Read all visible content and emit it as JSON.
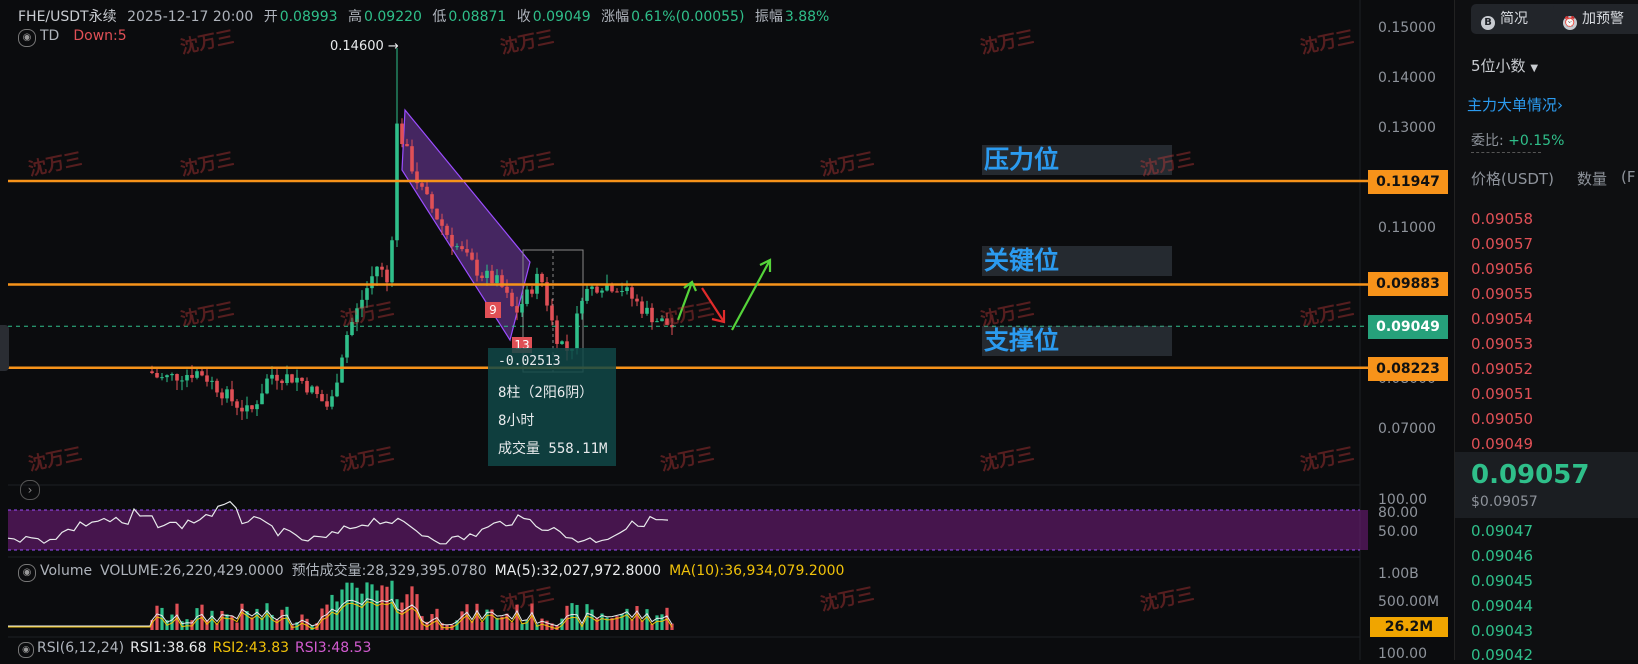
{
  "header": {
    "symbol": "FHE/USDT永续",
    "datetime": "2025-12-17 20:00",
    "open_label": "开",
    "open": "0.08993",
    "high_label": "高",
    "high": "0.09220",
    "low_label": "低",
    "low": "0.08871",
    "close_label": "收",
    "close": "0.09049",
    "change_label": "涨幅",
    "change": "0.61%(0.00055)",
    "amp_label": "振幅",
    "amp": "3.88%"
  },
  "indicator_row": {
    "name": "TD",
    "down": "Down:5"
  },
  "watermark": "沈万三",
  "peak_label": "0.14600 →",
  "td_labels": {
    "nine": "9",
    "thirteen": "13"
  },
  "measure_box": {
    "delta": "-0.02513",
    "bars": "8柱（2阳6阴）",
    "hours": "8小时",
    "volume": "成交量 558.11M"
  },
  "zones": {
    "pressure": "压力位",
    "key": "关键位",
    "support": "支撑位"
  },
  "price_axis": {
    "ticks": [
      "0.15000",
      "0.14000",
      "0.13000",
      "0.11000",
      "0.08000",
      "0.07000"
    ],
    "levels": [
      "0.11947",
      "0.09883",
      "0.09049",
      "0.08223"
    ]
  },
  "rsi_axis": {
    "ticks": [
      "100.00",
      "80.00",
      "50.00"
    ]
  },
  "volume_panel": {
    "label": "Volume",
    "volume": "VOLUME:26,220,429.0000",
    "est": "预估成交量:28,329,395.0780",
    "ma5": "MA(5):32,027,972.8000",
    "ma10": "MA(10):36,934,079.2000",
    "ticks": [
      "1.00B",
      "500.00M"
    ],
    "current": "26.2M"
  },
  "rsi_panel": {
    "label": "RSI(6,12,24)",
    "rsi1": "RSI1:38.68",
    "rsi2": "RSI2:43.83",
    "rsi3": "RSI3:48.53",
    "tick": "100.00"
  },
  "right_panel": {
    "btn_simple": "简况",
    "btn_alert": "加预警",
    "decimals": "5位小数",
    "main_orders": "主力大单情况",
    "ratio_label": "委比:",
    "ratio": "+0.15%",
    "col_price": "价格(USDT)",
    "col_qty": "数量",
    "col_extra": "(F",
    "asks": [
      "0.09058",
      "0.09057",
      "0.09056",
      "0.09055",
      "0.09054",
      "0.09053",
      "0.09052",
      "0.09051",
      "0.09050",
      "0.09049"
    ],
    "last": "0.09057",
    "last_sub": "$0.09057",
    "bids": [
      "0.09047",
      "0.09046",
      "0.09045",
      "0.09044",
      "0.09043",
      "0.09042"
    ]
  },
  "colors": {
    "up": "#2fbf8a",
    "down": "#e05056",
    "level": "#f7931a",
    "zone_text": "#2b9bf0"
  },
  "chart_data": {
    "type": "candlestick",
    "ylim": [
      0.065,
      0.152
    ],
    "levels": [
      0.11947,
      0.09883,
      0.09049,
      0.08223
    ],
    "peak": 0.146,
    "rsi_range": [
      50,
      100
    ]
  }
}
